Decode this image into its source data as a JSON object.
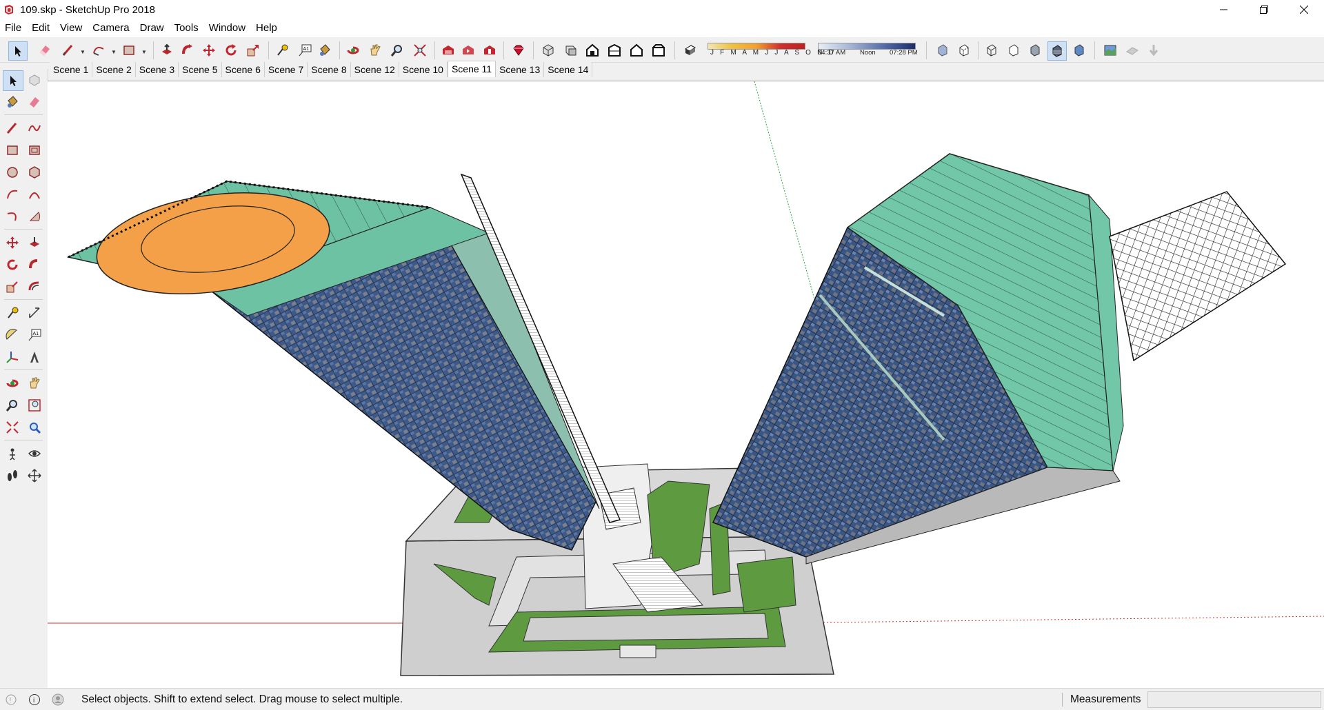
{
  "window": {
    "title": "109.skp - SketchUp Pro 2018",
    "icons": [
      "sketchup-logo-icon",
      "minimize-icon",
      "restore-icon",
      "close-icon"
    ]
  },
  "menu": {
    "items": [
      {
        "label": "File"
      },
      {
        "label": "Edit"
      },
      {
        "label": "View"
      },
      {
        "label": "Camera"
      },
      {
        "label": "Draw"
      },
      {
        "label": "Tools"
      },
      {
        "label": "Window"
      },
      {
        "label": "Help"
      }
    ]
  },
  "toolbar": {
    "tools": [
      "select-icon",
      "eraser-icon",
      "line-icon",
      "arc-icon",
      "rectangle-icon",
      "push-pull-icon",
      "follow-me-icon",
      "move-icon",
      "rotate-icon",
      "scale-icon",
      "tape-measure-icon",
      "text-icon",
      "paint-bucket-icon",
      "orbit-icon",
      "pan-icon",
      "zoom-icon",
      "zoom-extents-icon",
      "warehouse-icon",
      "share-model-icon",
      "extension-warehouse-icon",
      "ruby-icon",
      "iso-view-icon",
      "top-view-icon",
      "front-view-icon",
      "right-view-icon",
      "back-view-icon",
      "left-view-icon",
      "shadows-toggle-icon",
      "xray-icon",
      "back-edges-icon",
      "wireframe-icon",
      "hidden-line-icon",
      "shaded-icon",
      "shaded-textures-icon",
      "monochrome-icon",
      "add-location-icon",
      "toggle-terrain-icon",
      "photo-textures-icon"
    ],
    "shadow_months": "J F M A M J J A S O N D",
    "shadow_time_start": "04:37 AM",
    "shadow_time_mid": "Noon",
    "shadow_time_end": "07:28 PM"
  },
  "scenes": {
    "tabs": [
      {
        "label": "Scene 1"
      },
      {
        "label": "Scene 2"
      },
      {
        "label": "Scene 3"
      },
      {
        "label": "Scene 5"
      },
      {
        "label": "Scene 6"
      },
      {
        "label": "Scene 7"
      },
      {
        "label": "Scene 8"
      },
      {
        "label": "Scene 12"
      },
      {
        "label": "Scene 10"
      },
      {
        "label": "Scene 11",
        "active": true
      },
      {
        "label": "Scene 13"
      },
      {
        "label": "Scene 14"
      }
    ]
  },
  "left_toolbar": {
    "tools": [
      "select-icon",
      "make-component-icon",
      "paint-bucket-icon",
      "eraser-icon",
      "line-icon",
      "freehand-icon",
      "rectangle-icon",
      "rotated-rectangle-icon",
      "circle-icon",
      "polygon-icon",
      "arc-icon",
      "two-point-arc-icon",
      "three-point-arc-icon",
      "pie-icon",
      "move-icon",
      "push-pull-icon",
      "rotate-icon",
      "follow-me-icon",
      "scale-icon",
      "offset-icon",
      "tape-measure-icon",
      "dimension-icon",
      "protractor-icon",
      "text-icon",
      "axes-icon",
      "3d-text-icon",
      "orbit-icon",
      "pan-icon",
      "zoom-icon",
      "zoom-window-icon",
      "zoom-extents-icon",
      "previous-view-icon",
      "position-camera-icon",
      "look-around-icon",
      "walk-icon",
      "section-plane-icon"
    ]
  },
  "status": {
    "message": "Select objects. Shift to extend select. Drag mouse to select multiple.",
    "measurements_label": "Measurements",
    "measurements_value": "",
    "icons": [
      "geo-location-icon",
      "credits-icon",
      "user-account-icon"
    ]
  },
  "viewport": {
    "background": "#ffffff",
    "colors": {
      "roof_green": "#6ec2a4",
      "glass_blue": "#3e5a8a",
      "helipad_orange": "#f4a048",
      "plaza_grey": "#cfcfcf",
      "lawn_green": "#5e9a3f"
    }
  }
}
